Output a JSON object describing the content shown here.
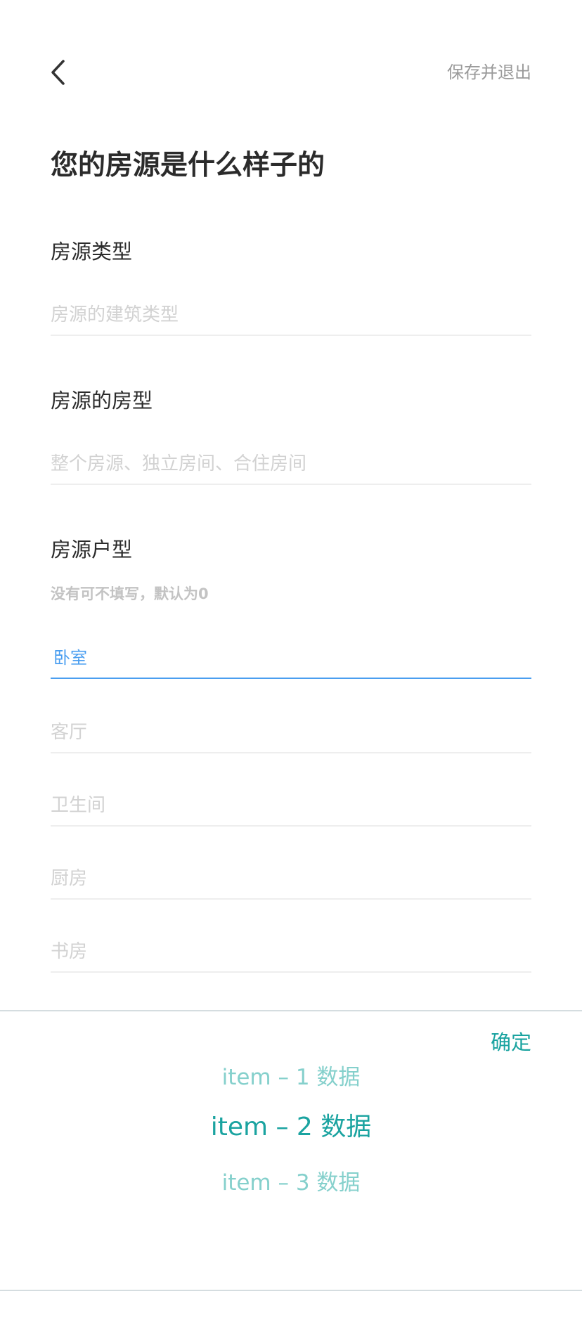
{
  "header": {
    "back_icon": "chevron-left-icon",
    "save_exit_label": "保存并退出"
  },
  "page": {
    "title": "您的房源是什么样子的"
  },
  "sections": {
    "property_type": {
      "label": "房源类型",
      "placeholder": "房源的建筑类型"
    },
    "room_type": {
      "label": "房源的房型",
      "placeholder": "整个房源、独立房间、合住房间"
    },
    "layout": {
      "label": "房源户型",
      "hint": "没有可不填写，默认为0",
      "fields": {
        "bedroom": "卧室",
        "living_room": "客厅",
        "bathroom": "卫生间",
        "kitchen": "厨房",
        "study": "书房"
      }
    }
  },
  "picker": {
    "confirm_label": "确定",
    "items": [
      "item – 1 数据",
      "item – 2 数据",
      "item – 3 数据"
    ],
    "selected_index": 1
  },
  "colors": {
    "accent": "#1aa3a0",
    "active_field": "#4a9ef0",
    "picker_item": "#85d0cc",
    "placeholder": "#d2d2d2"
  }
}
